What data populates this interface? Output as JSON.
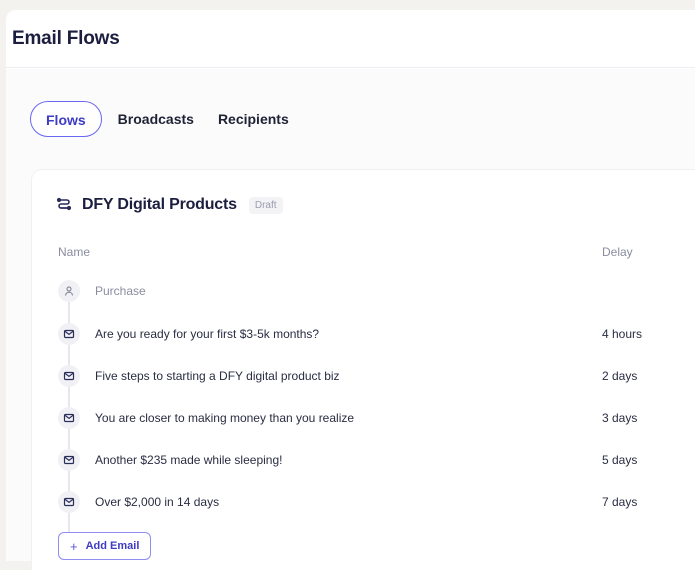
{
  "header": {
    "title": "Email Flows"
  },
  "tabs": [
    {
      "label": "Flows",
      "active": true
    },
    {
      "label": "Broadcasts",
      "active": false
    },
    {
      "label": "Recipients",
      "active": false
    }
  ],
  "flow": {
    "title": "DFY Digital Products",
    "status": "Draft",
    "columns": {
      "name": "Name",
      "delay": "Delay"
    },
    "trigger": {
      "label": "Purchase",
      "icon": "user-icon"
    },
    "emails": [
      {
        "subject": "Are you ready for your first $3-5k months?",
        "delay": "4 hours",
        "icon": "mail-icon"
      },
      {
        "subject": "Five steps to starting a DFY digital product biz",
        "delay": "2 days",
        "icon": "mail-icon"
      },
      {
        "subject": "You are closer to making money than you realize",
        "delay": "3 days",
        "icon": "mail-icon"
      },
      {
        "subject": "Another $235 made while sleeping!",
        "delay": "5 days",
        "icon": "mail-icon"
      },
      {
        "subject": "Over $2,000 in 14 days",
        "delay": "7 days",
        "icon": "mail-icon"
      }
    ],
    "add_button": {
      "label": "Add Email",
      "icon": "plus-icon"
    }
  },
  "colors": {
    "accent": "#6a67f0",
    "accent_text": "#3e3bc4",
    "title": "#1b1e3f",
    "muted": "#8a8da0",
    "page_bg": "#f4f2ee"
  }
}
